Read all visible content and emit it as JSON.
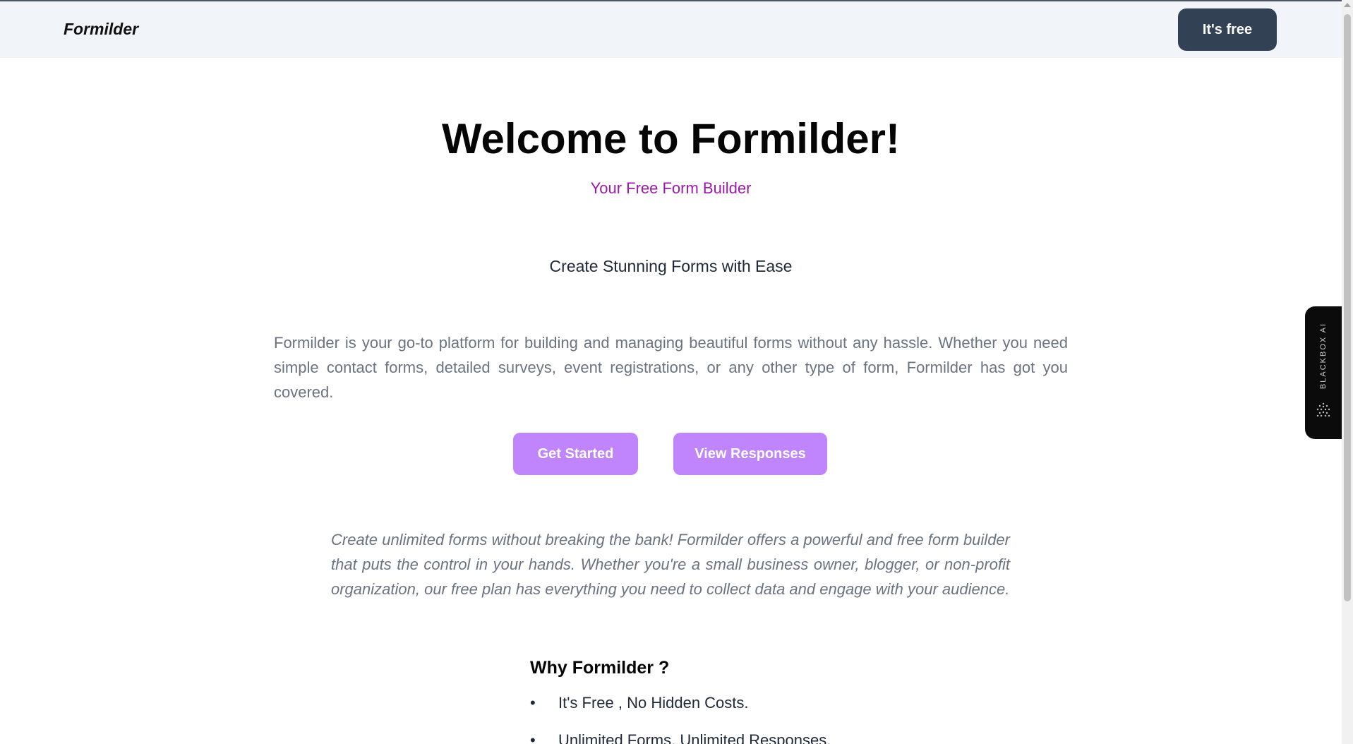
{
  "navbar": {
    "brand": "Formilder",
    "cta_label": "It's free"
  },
  "hero": {
    "title": "Welcome to Formilder!",
    "subtitle": "Your Free Form Builder",
    "tagline": "Create Stunning Forms with Ease",
    "intro": "Formilder is your go-to platform for building and managing beautiful forms without any hassle. Whether you need simple contact forms, detailed surveys, event registrations, or any other type of form, Formilder has got you covered.",
    "buttons": {
      "get_started": "Get Started",
      "view_responses": "View Responses"
    },
    "pitch": "Create unlimited forms without breaking the bank! Formilder offers a powerful and free form builder that puts the control in your hands. Whether you're a small business owner, blogger, or non-profit organization, our free plan has everything you need to collect data and engage with your audience."
  },
  "why": {
    "title": "Why Formilder ?",
    "items": [
      "It's Free , No Hidden Costs.",
      "Unlimited Forms, Unlimited Responses."
    ]
  },
  "side_widget": {
    "label": "BLACKBOX AI",
    "icon": "blackbox-dots-icon"
  },
  "colors": {
    "nav_bg": "#f1f4f8",
    "cta_bg": "#334155",
    "accent_purple": "#c084fc",
    "subtitle_purple": "#9b1aa8",
    "muted_text": "#6b7280"
  }
}
